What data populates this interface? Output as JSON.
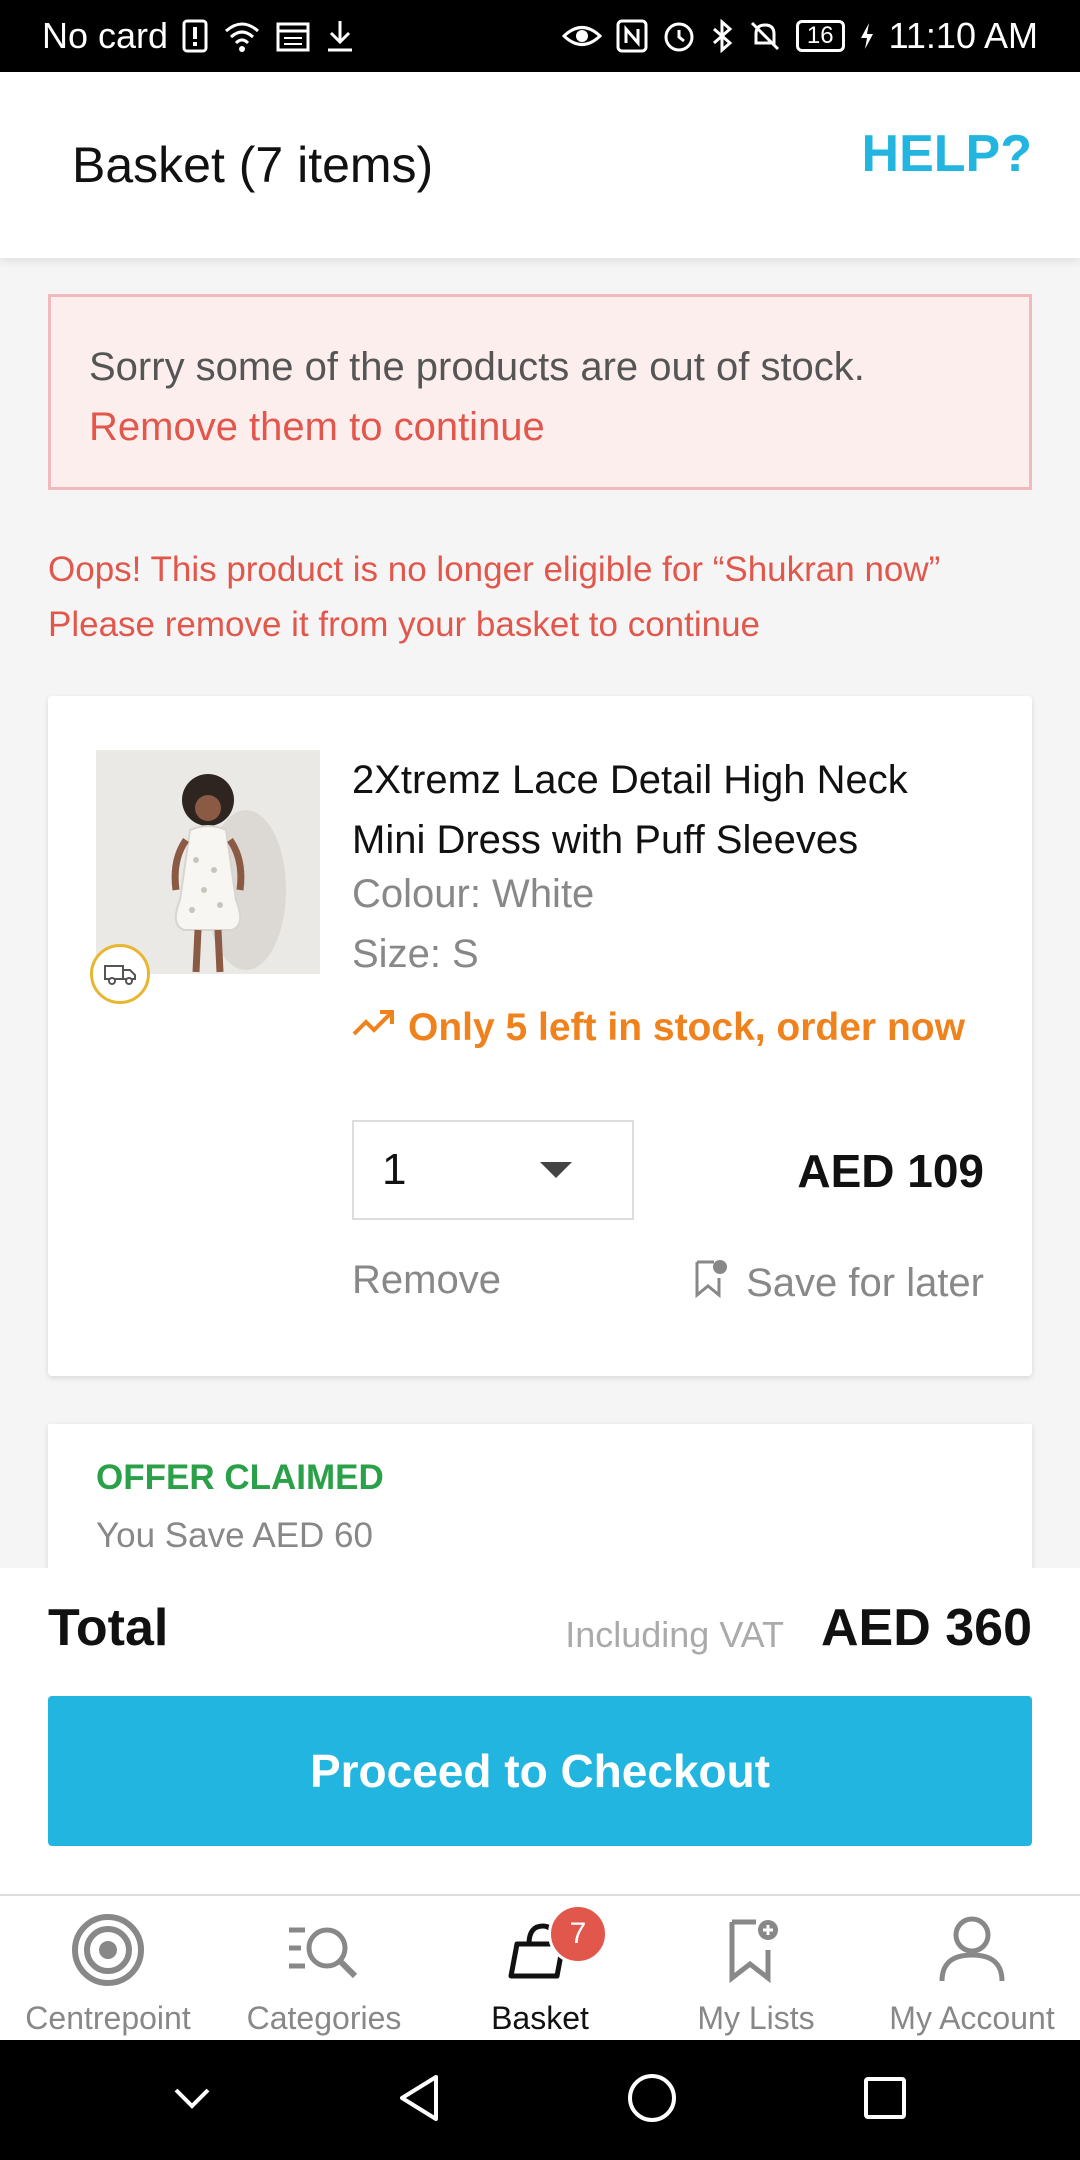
{
  "status_bar": {
    "carrier": "No card",
    "battery": "16",
    "time": "11:10 AM"
  },
  "header": {
    "title": "Basket (7 items)",
    "help_label": "HELP?"
  },
  "alert": {
    "message": "Sorry some of the products are out of stock.",
    "action": "Remove them to continue"
  },
  "eligibility": {
    "line1": "Oops! This product is no longer eligible for “Shukran now”",
    "line2": "Please remove it from your basket to continue"
  },
  "product": {
    "name": "2Xtremz Lace Detail High Neck Mini Dress with Puff Sleeves",
    "colour": "Colour: White",
    "size": "Size: S",
    "stock_message": "Only 5 left in stock, order now",
    "quantity": "1",
    "price": "AED 109",
    "remove_label": "Remove",
    "save_label": "Save for later"
  },
  "offer": {
    "title": "OFFER CLAIMED",
    "savings": "You Save AED 60"
  },
  "totals": {
    "label": "Total",
    "vat_note": "Including VAT",
    "value": "AED 360",
    "checkout_label": "Proceed to Checkout"
  },
  "bottom_nav": {
    "items": [
      {
        "label": "Centrepoint",
        "icon": "target-icon"
      },
      {
        "label": "Categories",
        "icon": "categories-search-icon"
      },
      {
        "label": "Basket",
        "icon": "basket-icon",
        "badge": "7"
      },
      {
        "label": "My Lists",
        "icon": "bookmark-add-icon"
      },
      {
        "label": "My Account",
        "icon": "user-icon"
      }
    ],
    "active": "Basket"
  },
  "colors": {
    "accent": "#22b5e0",
    "error": "#e2574c",
    "warning": "#f0821e",
    "success": "#2aa148"
  }
}
